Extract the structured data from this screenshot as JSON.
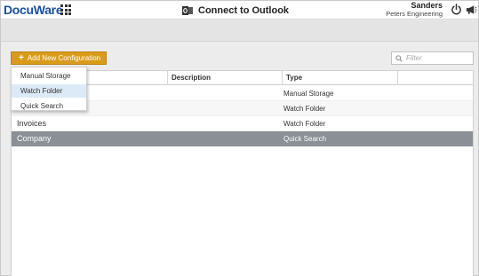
{
  "header": {
    "logo_text": "DocuWare",
    "title": "Connect to Outlook",
    "user_name": "Sanders",
    "user_org": "Peters Engineering"
  },
  "toolbar": {
    "add_button_label": "Add New Configuration",
    "filter_placeholder": "Filter"
  },
  "table": {
    "columns": [
      "",
      "Description",
      "Type"
    ],
    "rows": [
      {
        "name": "",
        "description": "",
        "type": "Manual Storage"
      },
      {
        "name": "",
        "description": "",
        "type": "Watch Folder"
      },
      {
        "name": "Invoices",
        "description": "",
        "type": "Watch Folder"
      },
      {
        "name": "Company",
        "description": "",
        "type": "Quick Search",
        "selected": true
      }
    ]
  },
  "dropdown": {
    "items": [
      "Manual Storage",
      "Watch Folder",
      "Quick Search"
    ],
    "active_index": 1
  },
  "colors": {
    "accent": "#d99c19",
    "logo": "#1b4f9c",
    "selected_row": "#8a9095",
    "dropdown_active": "#dbeaf6"
  },
  "icons": [
    "apps-grid-icon",
    "outlook-icon",
    "power-icon",
    "megaphone-icon",
    "search-icon",
    "plus-icon"
  ]
}
